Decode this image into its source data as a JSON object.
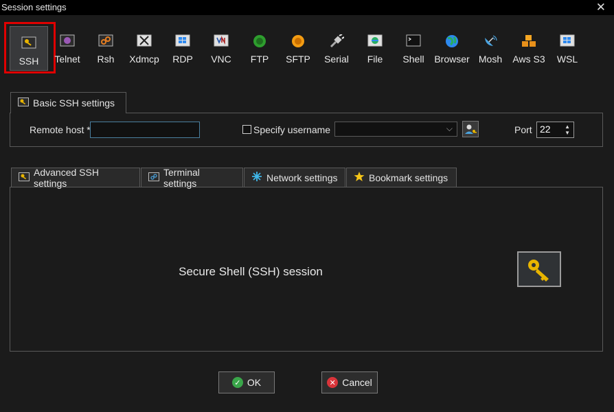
{
  "window": {
    "title": "Session settings",
    "close_glyph": "✕"
  },
  "session_types": [
    {
      "label": "SSH",
      "icon": "key-icon",
      "selected": true
    },
    {
      "label": "Telnet",
      "icon": "telnet-icon"
    },
    {
      "label": "Rsh",
      "icon": "rsh-icon"
    },
    {
      "label": "Xdmcp",
      "icon": "xdmcp-icon"
    },
    {
      "label": "RDP",
      "icon": "rdp-icon"
    },
    {
      "label": "VNC",
      "icon": "vnc-icon"
    },
    {
      "label": "FTP",
      "icon": "ftp-icon"
    },
    {
      "label": "SFTP",
      "icon": "sftp-icon"
    },
    {
      "label": "Serial",
      "icon": "serial-plug-icon"
    },
    {
      "label": "File",
      "icon": "file-icon"
    },
    {
      "label": "Shell",
      "icon": "shell-terminal-icon"
    },
    {
      "label": "Browser",
      "icon": "globe-icon"
    },
    {
      "label": "Mosh",
      "icon": "satellite-dish-icon"
    },
    {
      "label": "Aws S3",
      "icon": "aws-s3-cubes-icon"
    },
    {
      "label": "WSL",
      "icon": "windows-icon"
    }
  ],
  "basic": {
    "tab_label": "Basic SSH settings",
    "remote_host_label": "Remote host *",
    "remote_host_value": "",
    "specify_username_label": "Specify username",
    "specify_username_checked": false,
    "username_value": "",
    "port_label": "Port",
    "port_value": "22"
  },
  "tabs": [
    {
      "label": "Advanced SSH settings",
      "icon": "key-icon"
    },
    {
      "label": "Terminal settings",
      "icon": "terminal-icon"
    },
    {
      "label": "Network settings",
      "icon": "network-star-icon"
    },
    {
      "label": "Bookmark settings",
      "icon": "star-icon"
    }
  ],
  "description": "Secure Shell (SSH) session",
  "buttons": {
    "ok": "OK",
    "cancel": "Cancel"
  },
  "colors": {
    "background": "#1b1b1b",
    "selection_outline": "#e00000",
    "key_gold": "#e8b400",
    "ok_green": "#3aa64a",
    "cancel_red": "#d9343a",
    "input_focus_border": "#4a7f9f"
  }
}
